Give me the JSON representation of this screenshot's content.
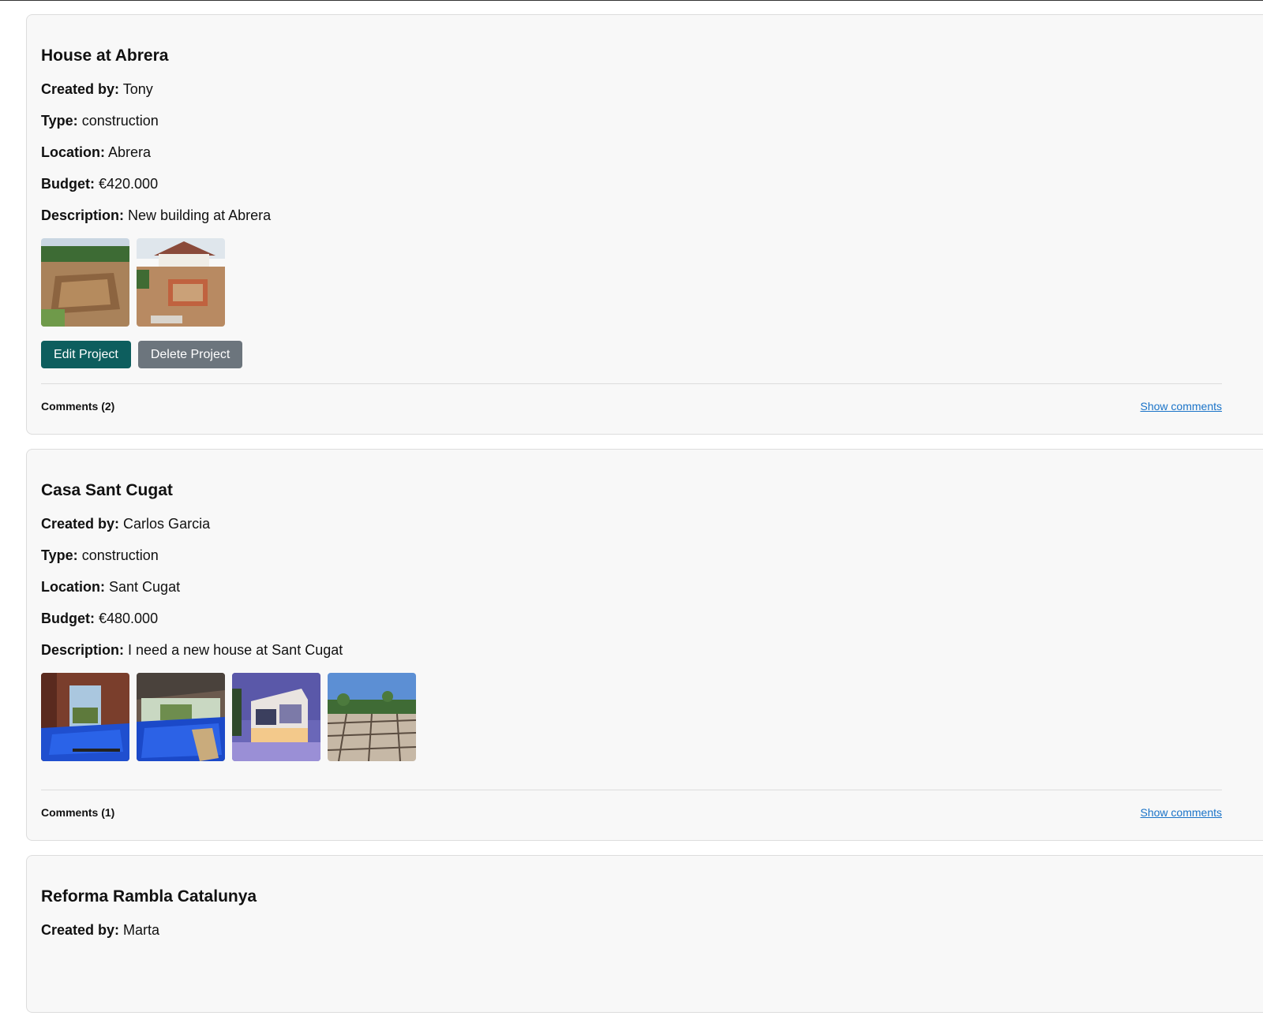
{
  "labels": {
    "created_by": "Created by:",
    "type": "Type:",
    "location": "Location:",
    "budget": "Budget:",
    "description": "Description:"
  },
  "projects": [
    {
      "title": "House at Abrera",
      "created_by": "Tony",
      "type": "construction",
      "location": "Abrera",
      "budget": "€420.000",
      "description": "New building at Abrera",
      "edit_label": "Edit Project",
      "delete_label": "Delete Project",
      "comments_label": "Comments (2)",
      "show_comments_label": "Show comments"
    },
    {
      "title": "Casa Sant Cugat",
      "created_by": "Carlos Garcia",
      "type": "construction",
      "location": "Sant Cugat",
      "budget": "€480.000",
      "description": "I need a new house at Sant Cugat",
      "comments_label": "Comments (1)",
      "show_comments_label": "Show comments"
    },
    {
      "title": "Reforma Rambla Catalunya",
      "created_by": "Marta"
    }
  ],
  "colors": {
    "primary_button": "#0d5e5e",
    "secondary_button": "#6c757d",
    "link": "#1a73c8",
    "card_background": "#f8f8f8"
  }
}
